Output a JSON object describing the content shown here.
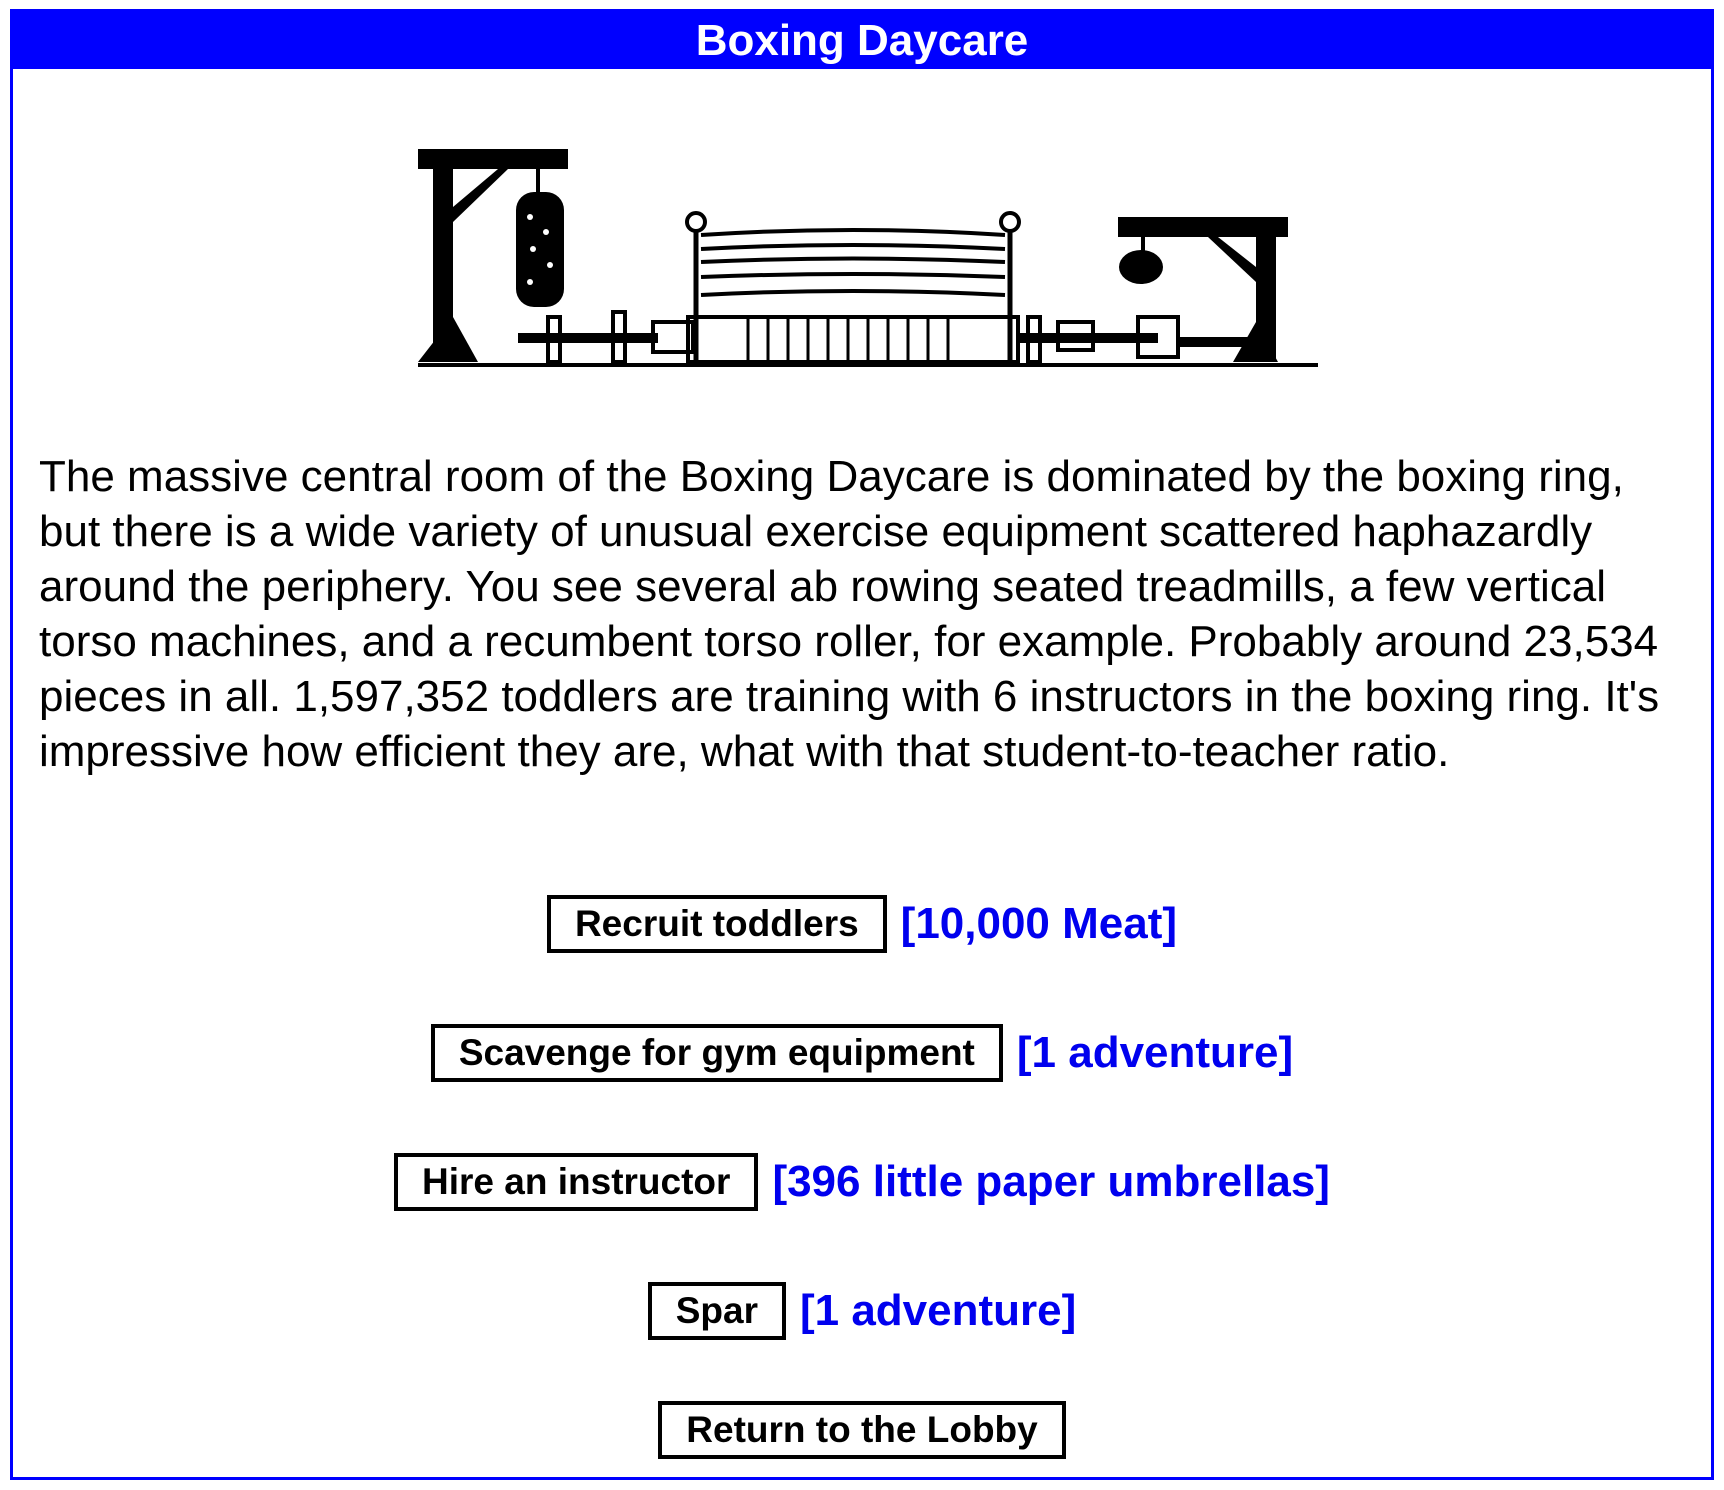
{
  "title": "Boxing Daycare",
  "description": "The massive central room of the Boxing Daycare is dominated by the boxing ring, but there is a wide variety of unusual exercise equipment scattered haphazardly around the periphery. You see several ab rowing seated treadmills, a few vertical torso machines, and a recumbent torso roller, for example. Probably around 23,534 pieces in all. 1,597,352 toddlers are training with 6 instructors in the boxing ring. It's impressive how efficient they are, what with that student-to-teacher ratio.",
  "actions": [
    {
      "label": "Recruit toddlers",
      "cost": "[10,000 Meat]"
    },
    {
      "label": "Scavenge for gym equipment",
      "cost": "[1 adventure]"
    },
    {
      "label": "Hire an instructor",
      "cost": "[396 little paper umbrellas]"
    },
    {
      "label": "Spar",
      "cost": "[1 adventure]"
    }
  ],
  "return_label": "Return to the Lobby",
  "colors": {
    "accent": "#0000ff",
    "cost_text": "#0000ee"
  }
}
